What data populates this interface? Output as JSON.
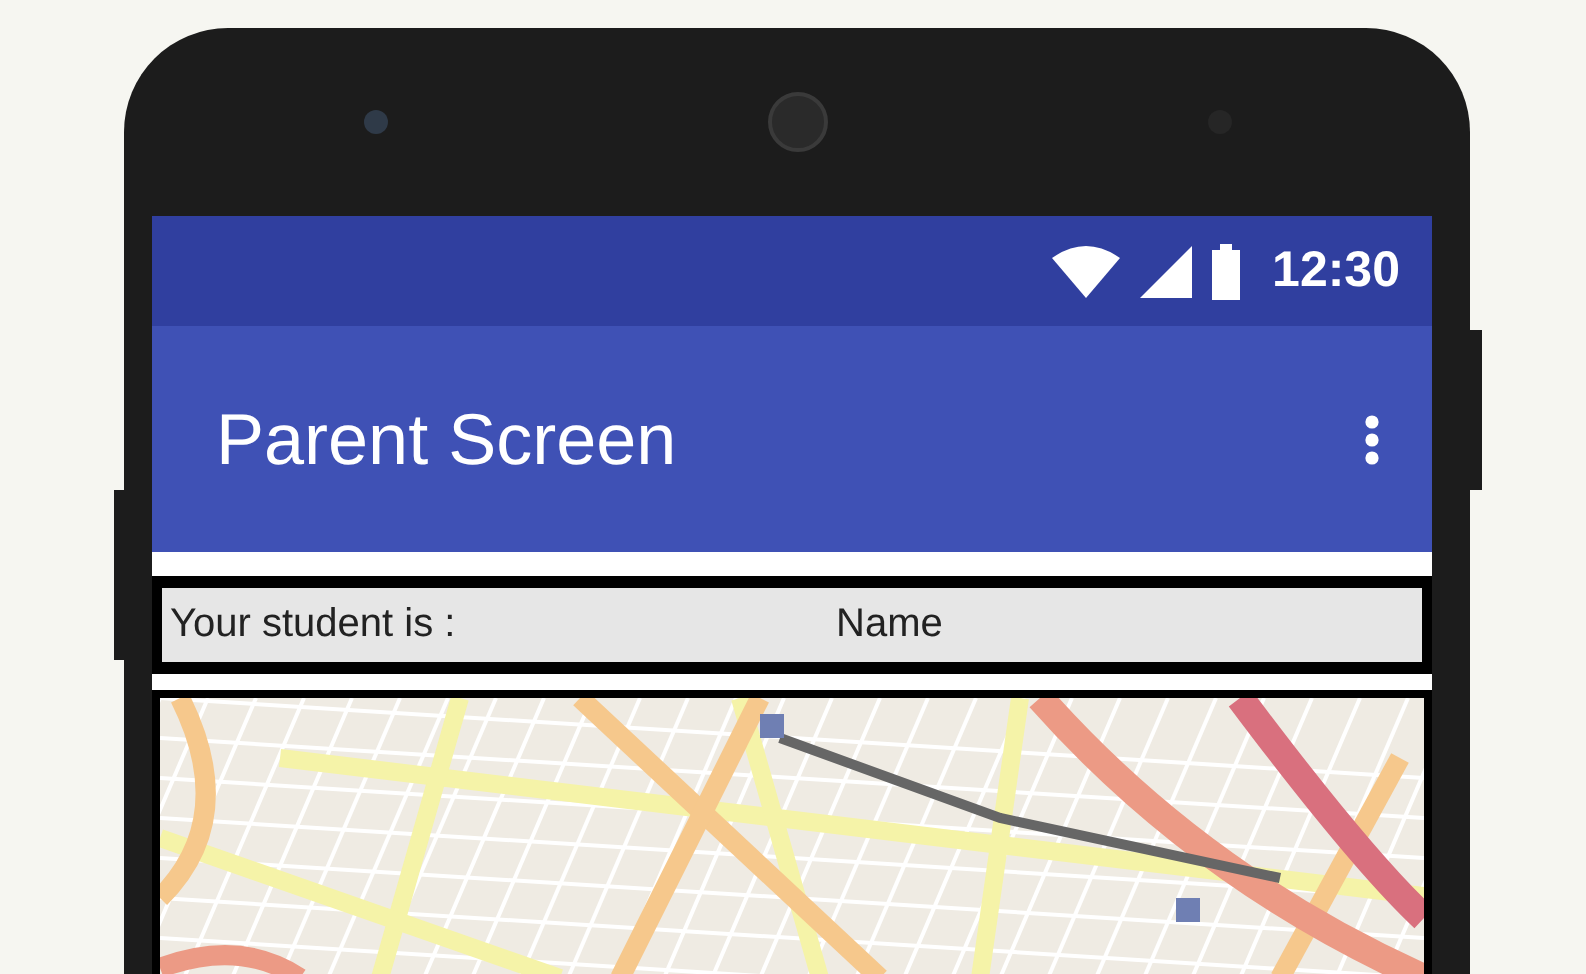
{
  "status_bar": {
    "time": "12:30"
  },
  "app_bar": {
    "title": "Parent Screen"
  },
  "student_row": {
    "label": "Your student is :",
    "value": "Name"
  }
}
